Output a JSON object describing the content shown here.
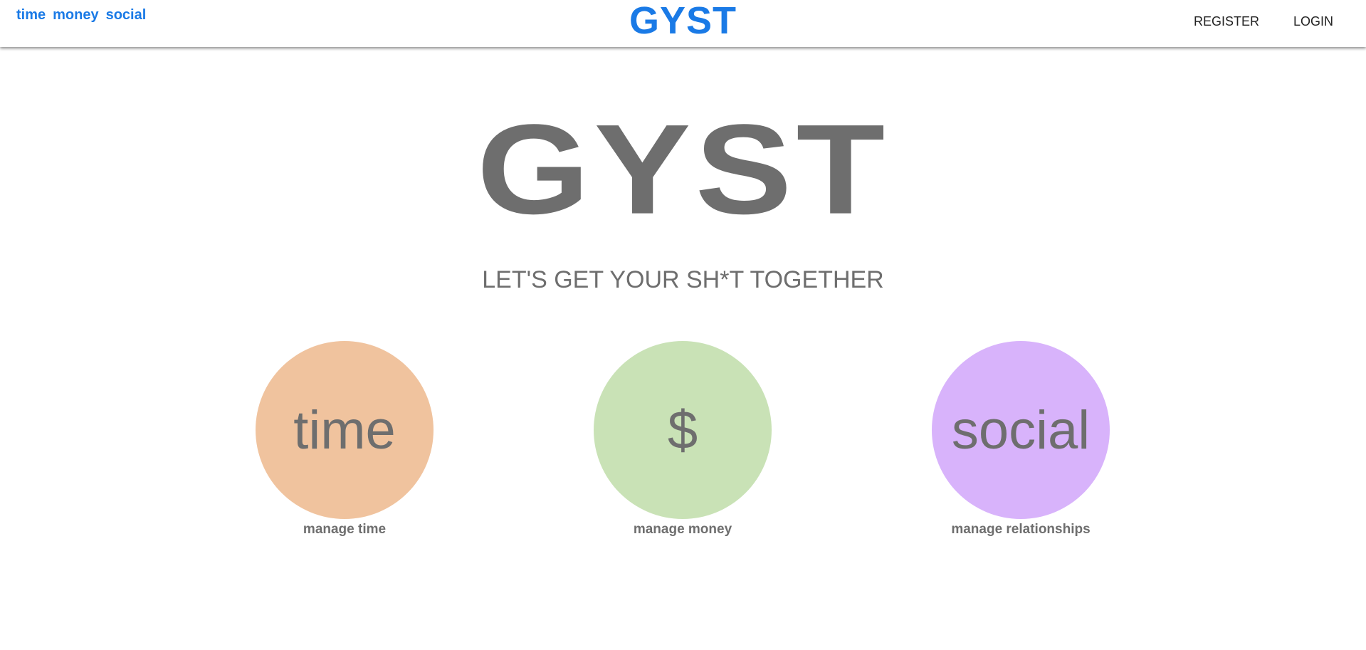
{
  "nav": {
    "links": [
      "time",
      "money",
      "social"
    ],
    "brand": "GYST",
    "register": "REGISTER",
    "login": "LOGIN"
  },
  "hero": {
    "title": "GYST",
    "tagline": "LET'S GET YOUR SH*T TOGETHER"
  },
  "features": [
    {
      "label": "time",
      "caption": "manage time",
      "color": "#f0c39e"
    },
    {
      "label": "$",
      "caption": "manage money",
      "color": "#c9e2b6"
    },
    {
      "label": "social",
      "caption": "manage relationships",
      "color": "#d8b3fb"
    }
  ],
  "colors": {
    "accent": "#1a7ae6",
    "text_gray": "#6e6e6e"
  }
}
